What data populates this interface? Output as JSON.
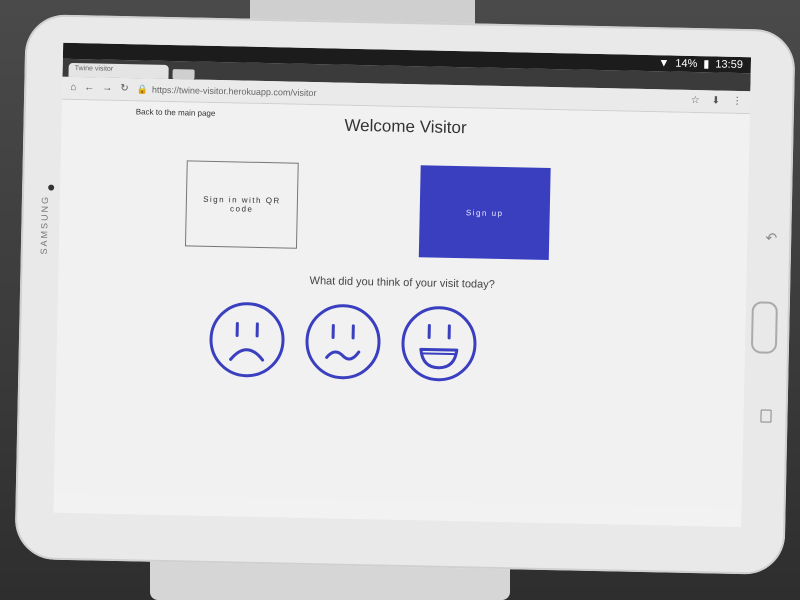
{
  "device": {
    "brand": "SAMSUNG"
  },
  "status_bar": {
    "battery": "14%",
    "time": "13:59"
  },
  "browser": {
    "tab_title": "Twine visitor",
    "url": "https://twine-visitor.herokuapp.com/visitor"
  },
  "page": {
    "back_link": "Back to the main page",
    "title": "Welcome Visitor",
    "qr_button": "Sign in with QR code",
    "signup_button": "Sign up",
    "feedback_question": "What did you think of your visit today?",
    "feedback_options": [
      "sad-face-icon",
      "confused-face-icon",
      "happy-face-icon"
    ]
  },
  "colors": {
    "accent": "#3a3fc0"
  }
}
